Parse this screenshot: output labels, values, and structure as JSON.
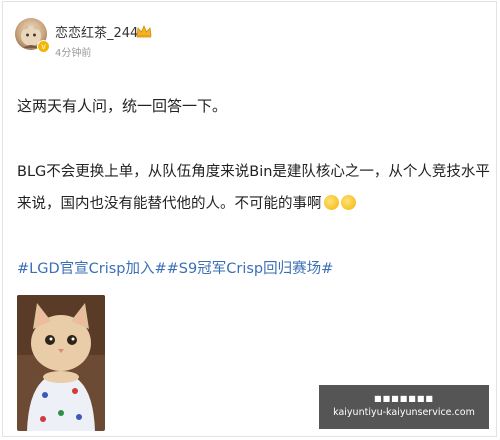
{
  "post": {
    "author": {
      "name": "恋恋红茶_244",
      "avatar_icon": "avatar-cat",
      "badge_icon": "crown-icon"
    },
    "time": "4分钟前",
    "paragraph1": "这两天有人问，统一回答一下。",
    "paragraph2": "BLG不会更换上单，从队伍角度来说Bin是建队核心之一，从个人竞技水平来说，国内也没有能替代他的人。不可能的事啊",
    "topics": "#LGD官宣Crisp加入##S9冠军Crisp回归赛场#",
    "link_color": "#3b6fb6"
  },
  "watermark": {
    "line1": "■■■■■■■",
    "line2": "kaiyuntiyu-kaiyunservice.com"
  }
}
